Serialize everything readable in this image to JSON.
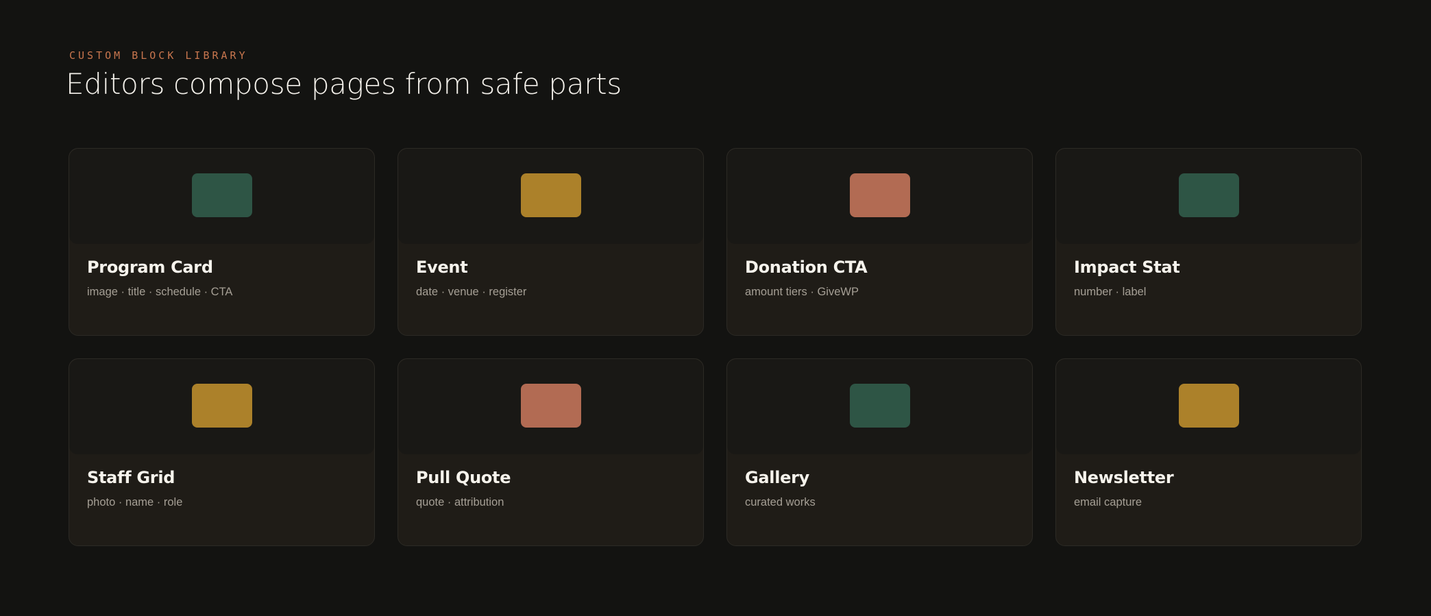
{
  "header": {
    "eyebrow": "CUSTOM BLOCK LIBRARY",
    "title": "Editors compose pages from safe parts"
  },
  "colors": {
    "green": "#2e5545",
    "gold": "#ac812a",
    "terracotta": "#b26b53",
    "accent": "#c8764e"
  },
  "blocks": [
    {
      "name": "Program Card",
      "fields": "image · title · schedule · CTA",
      "swatch": "#2e5545"
    },
    {
      "name": "Event",
      "fields": "date · venue · register",
      "swatch": "#ac812a"
    },
    {
      "name": "Donation CTA",
      "fields": "amount tiers · GiveWP",
      "swatch": "#b26b53"
    },
    {
      "name": "Impact Stat",
      "fields": "number · label",
      "swatch": "#2e5545"
    },
    {
      "name": "Staff Grid",
      "fields": "photo · name · role",
      "swatch": "#ac812a"
    },
    {
      "name": "Pull Quote",
      "fields": "quote · attribution",
      "swatch": "#b26b53"
    },
    {
      "name": "Gallery",
      "fields": "curated works",
      "swatch": "#2e5545"
    },
    {
      "name": "Newsletter",
      "fields": "email capture",
      "swatch": "#ac812a"
    }
  ]
}
